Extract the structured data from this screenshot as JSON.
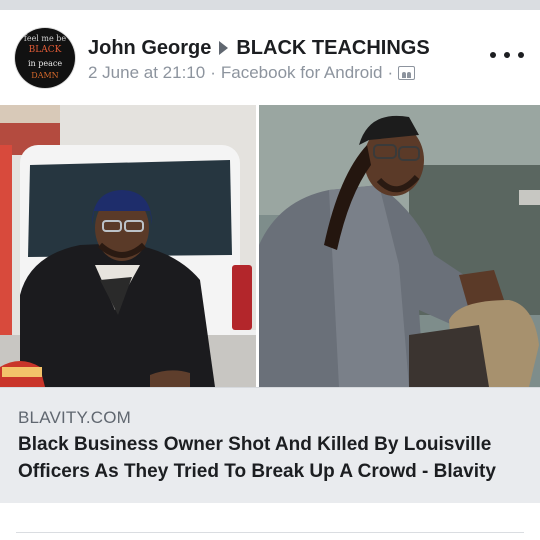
{
  "post": {
    "author": "John George",
    "group": "BLACK TEACHINGS",
    "date": "2 June at 21:10",
    "source": "Facebook for Android",
    "separator": "·",
    "audience_icon": "group-icon",
    "avatar": {
      "lines": [
        "feel me be",
        "BLACK",
        "in peace",
        "DAMN"
      ]
    }
  },
  "link_preview": {
    "domain": "BLAVITY.COM",
    "headline": "Black Business Owner Shot And Killed By Louisville Officers As They Tried To Break Up A Crowd - Blavity"
  },
  "colors": {
    "title": "#1c1e21",
    "meta": "#8d949e",
    "link_box_bg": "#e9ebee",
    "top_strip": "#dadde1"
  }
}
